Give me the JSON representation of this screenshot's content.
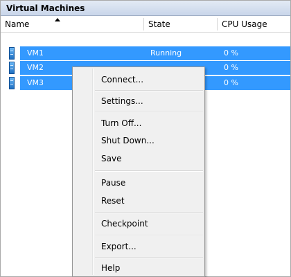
{
  "panel": {
    "title": "Virtual Machines"
  },
  "columns": {
    "name": "Name",
    "state": "State",
    "cpu": "CPU Usage"
  },
  "rows": [
    {
      "name": "VM1",
      "state": "Running",
      "cpu": "0 %"
    },
    {
      "name": "VM2",
      "state": "",
      "cpu": "0 %"
    },
    {
      "name": "VM3",
      "state": "",
      "cpu": "0 %"
    }
  ],
  "menu": {
    "connect": "Connect...",
    "settings": "Settings...",
    "turn_off": "Turn Off...",
    "shut_down": "Shut Down...",
    "save": "Save",
    "pause": "Pause",
    "reset": "Reset",
    "checkpoint": "Checkpoint",
    "export": "Export...",
    "help": "Help"
  },
  "colors": {
    "selection": "#3399ff",
    "menu_bg": "#f0f0f0"
  },
  "icons": {
    "vm": "virtual-machine-icon",
    "sort": "sort-ascending-icon"
  }
}
